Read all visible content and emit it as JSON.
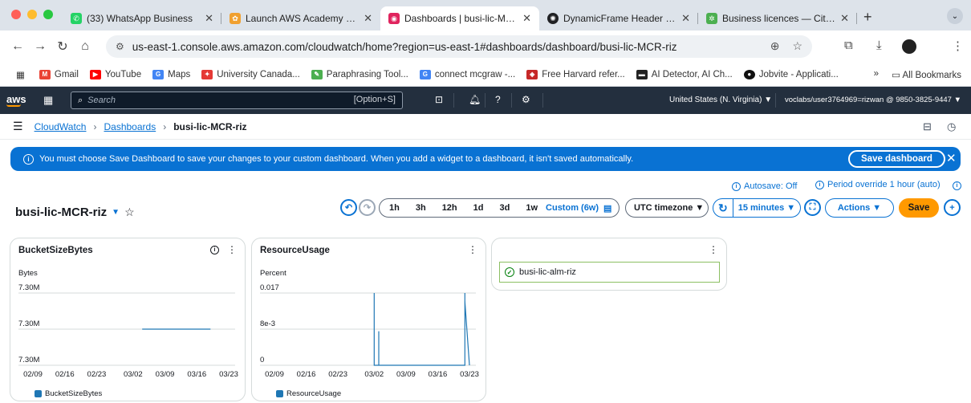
{
  "browser": {
    "tabs": [
      {
        "label": "(33) WhatsApp Business",
        "color": "#25d366"
      },
      {
        "label": "Launch AWS Academy Learner Lab",
        "color": "#f0a030"
      },
      {
        "label": "Dashboards | busi-lic-MCR-riz",
        "color": "#e0245e"
      },
      {
        "label": "DynamicFrame Header Issue",
        "color": "#202124"
      },
      {
        "label": "Business licences — City of Vancouver",
        "color": "#4caf50"
      }
    ],
    "url": "us-east-1.console.aws.amazon.com/cloudwatch/home?region=us-east-1#dashboards/dashboard/busi-lic-MCR-riz",
    "bookmarks": [
      {
        "label": "Gmail",
        "color": "#ea4335"
      },
      {
        "label": "YouTube",
        "color": "#ff0000"
      },
      {
        "label": "Maps",
        "color": "#4285f4"
      },
      {
        "label": "University Canada...",
        "color": "#e53935"
      },
      {
        "label": "Paraphrasing Tool...",
        "color": "#4caf50"
      },
      {
        "label": "connect mcgraw -...",
        "color": "#4285f4"
      },
      {
        "label": "Free Harvard refer...",
        "color": "#c62828"
      },
      {
        "label": "AI Detector, AI Ch...",
        "color": "#222222"
      },
      {
        "label": "Jobvite - Applicati...",
        "color": "#111111"
      }
    ],
    "bookmarks_more": "»",
    "all_bookmarks": "All Bookmarks"
  },
  "aws": {
    "logo": "aws",
    "search_placeholder": "Search",
    "search_shortcut": "[Option+S]",
    "region": "United States (N. Virginia) ▼",
    "account": "voclabs/user3764969=rizwan @ 9850-3825-9447 ▼"
  },
  "breadcrumb": {
    "items": [
      "CloudWatch",
      "Dashboards"
    ],
    "current": "busi-lic-MCR-riz"
  },
  "banner": {
    "message": "You must choose Save Dashboard to save your changes to your custom dashboard. When you add a widget to a dashboard, it isn't saved automatically.",
    "button": "Save dashboard"
  },
  "dashboard": {
    "title": "busi-lic-MCR-riz",
    "autosave": "Autosave: Off",
    "period_override": "Period override 1 hour (auto)",
    "ranges": [
      "1h",
      "3h",
      "12h",
      "1d",
      "3d",
      "1w"
    ],
    "custom_range": "Custom (6w)",
    "timezone": "UTC timezone ▼",
    "refresh": "15 minutes ▼",
    "actions": "Actions ▼",
    "save": "Save"
  },
  "widgets": {
    "bucket": {
      "title": "BucketSizeBytes",
      "legend": "BucketSizeBytes"
    },
    "resource": {
      "title": "ResourceUsage",
      "legend": "ResourceUsage"
    },
    "alarm": {
      "label": "busi-lic-alm-riz"
    }
  },
  "chart_data": [
    {
      "type": "line",
      "title": "BucketSizeBytes",
      "ylabel": "Bytes",
      "yticks": [
        "7.30M",
        "7.30M",
        "7.30M"
      ],
      "xticks": [
        "02/09",
        "02/16",
        "02/23",
        "03/02",
        "03/09",
        "03/16",
        "03/23"
      ],
      "series": [
        {
          "name": "BucketSizeBytes",
          "color": "#1f77b4",
          "points": [
            [
              "03/04",
              7.3
            ],
            [
              "03/19",
              7.3
            ]
          ]
        }
      ],
      "grid": true
    },
    {
      "type": "line",
      "title": "ResourceUsage",
      "ylabel": "Percent",
      "yticks": [
        "0.017",
        "8e-3",
        "0"
      ],
      "ylim": [
        0,
        0.017
      ],
      "xticks": [
        "02/09",
        "02/16",
        "02/23",
        "03/02",
        "03/09",
        "03/16",
        "03/23"
      ],
      "series": [
        {
          "name": "ResourceUsage",
          "color": "#1f77b4",
          "points": [
            [
              "03/02",
              0
            ],
            [
              "03/02",
              0.017
            ],
            [
              "03/02",
              0
            ],
            [
              "03/03",
              0
            ],
            [
              "03/03",
              0.008
            ],
            [
              "03/03",
              0
            ],
            [
              "03/22",
              0
            ],
            [
              "03/22",
              0.017
            ],
            [
              "03/22",
              0.015
            ],
            [
              "03/23",
              0
            ]
          ]
        }
      ],
      "grid": true
    }
  ]
}
